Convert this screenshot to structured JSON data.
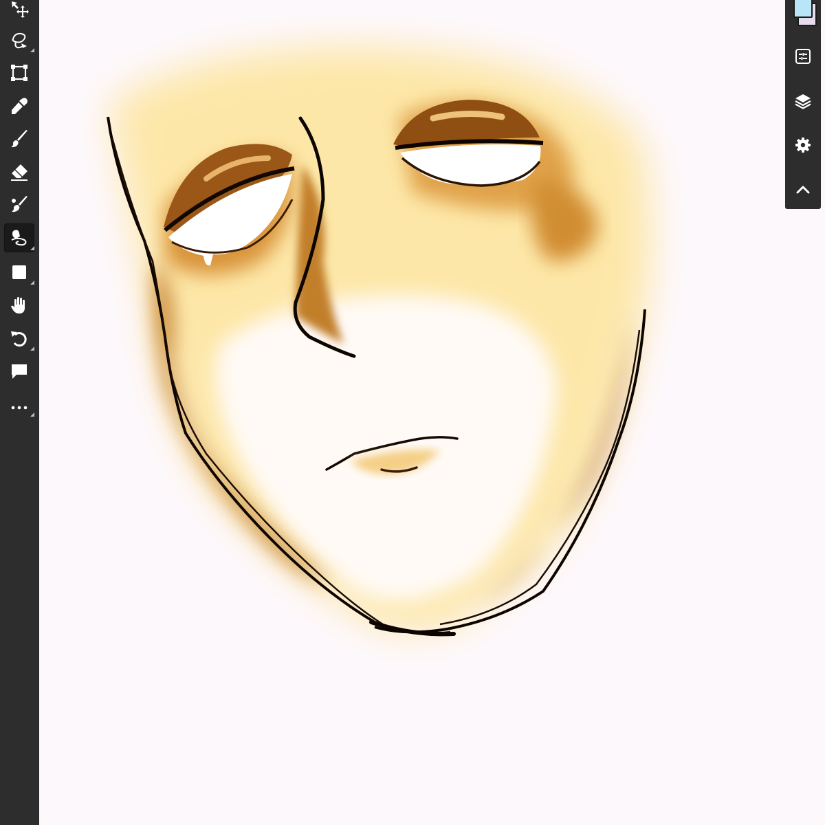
{
  "app": {
    "left_toolbar": {
      "tools": [
        {
          "name": "move",
          "icon": "move-icon"
        },
        {
          "name": "lasso",
          "icon": "lasso-icon"
        },
        {
          "name": "transform",
          "icon": "transform-icon"
        },
        {
          "name": "eyedropper",
          "icon": "eyedropper-icon"
        },
        {
          "name": "brush",
          "icon": "brush-icon"
        },
        {
          "name": "eraser",
          "icon": "eraser-icon"
        },
        {
          "name": "blend",
          "icon": "blend-brush-icon"
        },
        {
          "name": "smudge",
          "icon": "smudge-icon",
          "active": true
        },
        {
          "name": "shape",
          "icon": "shape-icon"
        },
        {
          "name": "hand",
          "icon": "hand-icon"
        },
        {
          "name": "undo",
          "icon": "undo-icon"
        },
        {
          "name": "comment",
          "icon": "comment-icon"
        },
        {
          "name": "more",
          "icon": "more-icon"
        }
      ]
    },
    "right_panel": {
      "primary_color": "#b8e6f7",
      "secondary_color": "#e6dcf0",
      "buttons": [
        {
          "name": "adjustments",
          "icon": "sliders-icon"
        },
        {
          "name": "layers",
          "icon": "layers-icon"
        },
        {
          "name": "settings",
          "icon": "gear-icon"
        },
        {
          "name": "collapse",
          "icon": "chevron-up-icon"
        }
      ]
    },
    "canvas": {
      "background_color": "#fdf8fc",
      "artwork": "face-sketch"
    }
  }
}
